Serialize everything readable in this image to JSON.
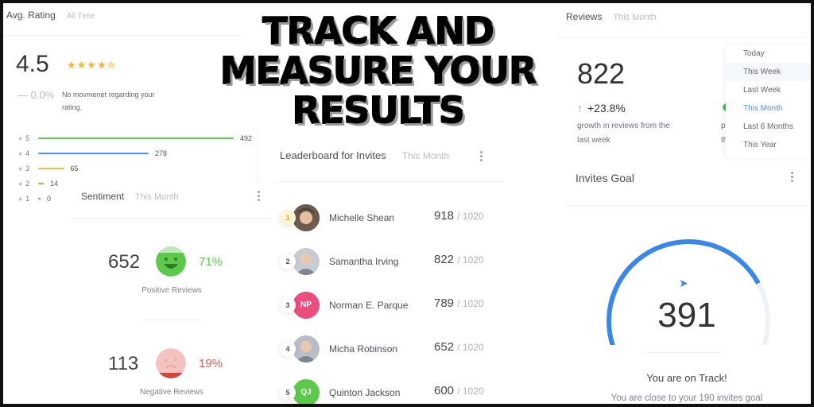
{
  "headline": {
    "line1": "TRACK AND",
    "line2": "MEASURE YOUR",
    "line3": "RESULTS"
  },
  "avg_rating": {
    "title": "Avg. Rating",
    "period": "All Time",
    "value": "4.5",
    "stars": "★★★★✮",
    "star_rating": 4.5,
    "delta": "— 0.0%",
    "note": "No movmenet regarding your rating.",
    "distribution": [
      {
        "star": "5",
        "count": "492",
        "value": 492,
        "color": "#5cc94a"
      },
      {
        "star": "4",
        "count": "278",
        "value": 278,
        "color": "#4a8ff0"
      },
      {
        "star": "3",
        "count": "65",
        "value": 65,
        "color": "#f5c046"
      },
      {
        "star": "2",
        "count": "14",
        "value": 14,
        "color": "#f08a3c"
      },
      {
        "star": "1",
        "count": "0",
        "value": 0,
        "color": "#f06a5a"
      }
    ],
    "star_glyph": "★"
  },
  "sentiment": {
    "title": "Sentiment",
    "period": "This Month",
    "positive": {
      "count": "652",
      "percent": "71%",
      "label": "Positive Reviews",
      "color": "#5cc94a"
    },
    "negative": {
      "count": "113",
      "percent": "19%",
      "label": "Negative Reviews",
      "color": "#e05a4f"
    }
  },
  "leaderboard": {
    "title": "Leaderboard for Invites",
    "period": "This Month",
    "rows": [
      {
        "rank": "1",
        "name": "Michelle Shean",
        "score": "918",
        "total": "/ 1020",
        "initials": "",
        "avatar_color": "#8a6a5a"
      },
      {
        "rank": "2",
        "name": "Samantha Irving",
        "score": "822",
        "total": "/ 1020",
        "initials": "",
        "avatar_color": "#c8ccd2"
      },
      {
        "rank": "3",
        "name": "Norman E. Parque",
        "score": "789",
        "total": "/ 1020",
        "initials": "NP",
        "avatar_color": "#ec4d7f"
      },
      {
        "rank": "4",
        "name": "Micha Robinson",
        "score": "652",
        "total": "/ 1020",
        "initials": "",
        "avatar_color": "#b9bec6"
      },
      {
        "rank": "5",
        "name": "Quinton Jackson",
        "score": "600",
        "total": "/ 1020",
        "initials": "QJ",
        "avatar_color": "#5cc94a"
      }
    ]
  },
  "reviews": {
    "title": "Reviews",
    "period": "This Month",
    "value": "822",
    "growth_arrow": "↑",
    "growth": "+23.8%",
    "growth_desc": "growth in reviews from the last week",
    "hidden_desc": "p\nth"
  },
  "period_dropdown": {
    "options": [
      "Today",
      "This Week",
      "Last Week",
      "This Month",
      "Last 6 Months",
      "This Year"
    ],
    "hovered": "This Week",
    "selected": "This Month"
  },
  "invites_goal": {
    "title": "Invites Goal",
    "value": "391",
    "arrow": "➤",
    "progress_fraction": 0.78,
    "status": "You are on Track!",
    "note": "You are close to your 190 invites goal",
    "accent": "#3a87ec"
  }
}
